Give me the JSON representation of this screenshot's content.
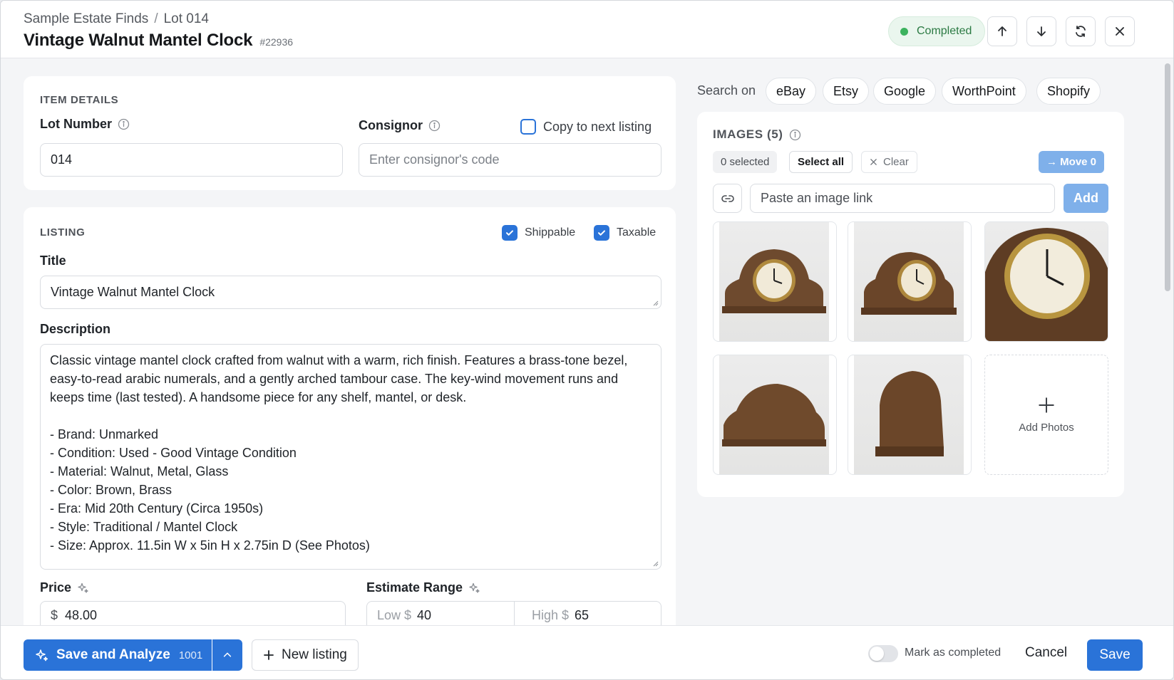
{
  "breadcrumb": {
    "parent": "Sample Estate Finds",
    "separator": "/",
    "current": "Lot 014"
  },
  "page": {
    "title": "Vintage Walnut Mantel Clock",
    "id": "#22936"
  },
  "status": {
    "label": "Completed",
    "color": "#3cb25e"
  },
  "header_actions": [
    "arrow-up-icon",
    "arrow-down-icon",
    "refresh-icon",
    "close-icon"
  ],
  "item_details": {
    "section_label": "ITEM DETAILS",
    "lot_number_label": "Lot Number",
    "lot_number_value": "014",
    "consignor_label": "Consignor",
    "consignor_placeholder": "Enter consignor's code",
    "copy_next_label": "Copy to next listing"
  },
  "listing": {
    "section_label": "LISTING",
    "shippable_label": "Shippable",
    "taxable_label": "Taxable",
    "title_label": "Title",
    "title_value": "Vintage Walnut Mantel Clock",
    "description_label": "Description",
    "description_value": "Classic vintage mantel clock crafted from walnut with a warm, rich finish. Features a brass-tone bezel, easy-to-read arabic numerals, and a gently arched tambour case. The key-wind movement runs and keeps time (last tested). A handsome piece for any shelf, mantel, or desk.\n\n- Brand: Unmarked\n- Condition: Used - Good Vintage Condition\n- Material: Walnut, Metal, Glass\n- Color: Brown, Brass\n- Era: Mid 20th Century (Circa 1950s)\n- Style: Traditional / Mantel Clock\n- Size: Approx. 11.5in W x 5in H x 2.75in D (See Photos)",
    "price_label": "Price",
    "price_prefix": "$",
    "price_value": "48.00",
    "estimate_label": "Estimate Range",
    "low_prefix": "Low $",
    "low_value": "40",
    "high_prefix": "High $",
    "high_value": "65"
  },
  "search": {
    "label": "Search on",
    "sites": [
      "eBay",
      "Etsy",
      "Google",
      "WorthPoint",
      "Shopify"
    ]
  },
  "images": {
    "label": "IMAGES (5)",
    "selected": "0 selected",
    "select_all": "Select all",
    "clear": "Clear",
    "move": "→ Move 0",
    "link_placeholder": "Paste an image link",
    "add": "Add",
    "add_photos": "Add Photos"
  },
  "footer": {
    "save_analyze": "Save and Analyze",
    "save_analyze_count": "1001",
    "new_listing": "New listing",
    "mark_completed": "Mark as completed",
    "cancel": "Cancel",
    "save": "Save"
  },
  "colors": {
    "accent": "#2a73d8",
    "success": "#3cb25e"
  }
}
